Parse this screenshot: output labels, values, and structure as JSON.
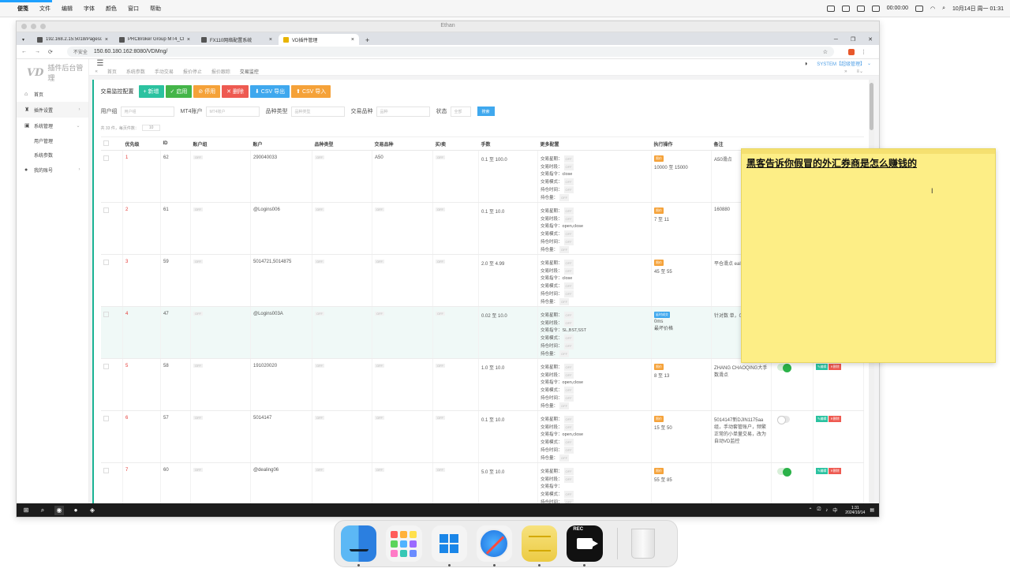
{
  "mac_menu": {
    "app": "便笺",
    "items": [
      "文件",
      "编辑",
      "字体",
      "颜色",
      "窗口",
      "帮助"
    ],
    "status_time": "00:00:00",
    "date_time": "10月14日 周一 01:31"
  },
  "remote": {
    "title": "Ethan",
    "tabs": [
      {
        "label": "192.168.2.15:5018/Pages/A"
      },
      {
        "label": "PRCBroker Group MT4_CRM"
      },
      {
        "label": "FX110网络配置系统"
      },
      {
        "label": "VD插件管理"
      }
    ],
    "insecure_label": "不安全",
    "url": "150.60.180.162:8080/VDMng/"
  },
  "app": {
    "brand_mark": "VD",
    "brand_title": "插件后台管理",
    "user_label": "SYSTEM【超级管理】",
    "sidebar": [
      {
        "label": "首页",
        "icon": "⌂"
      },
      {
        "label": "插件设置",
        "icon": "♜"
      },
      {
        "label": "系统管理",
        "icon": "▣"
      },
      {
        "label": "用户管理",
        "icon": ""
      },
      {
        "label": "系统参数",
        "icon": ""
      },
      {
        "label": "我的账号",
        "icon": "●"
      }
    ],
    "breadcrumbs": [
      "首页",
      "系统参数",
      "手动交易",
      "报价停止",
      "报价跟踪",
      "交易监控"
    ],
    "panel_title": "交易监控配置",
    "buttons": [
      "+ 新增",
      "✓ 启用",
      "⊘ 停用",
      "✕ 删除",
      "⬇ CSV 导出",
      "⬆ CSV 导入"
    ],
    "filters": [
      {
        "label": "用户组",
        "placeholder": "用户组"
      },
      {
        "label": "MT4账户",
        "placeholder": "MT4账户"
      },
      {
        "label": "品种类型",
        "placeholder": "品种类型"
      },
      {
        "label": "交易品种",
        "placeholder": "品种"
      },
      {
        "label": "状态",
        "placeholder": "全部"
      }
    ],
    "search_button": "搜索",
    "page_info": "共 33 件，每页件数：",
    "page_size": "10",
    "columns": [
      "",
      "优先级",
      "ID",
      "账户组",
      "账户",
      "品种类型",
      "交易品种",
      "买/卖",
      "手数",
      "更多配置",
      "执行操作",
      "备注",
      "",
      ""
    ],
    "rows": [
      {
        "priority": "1",
        "id": "62",
        "account": "290040033",
        "symbol": "A50",
        "lots": "0.1 至 100.0",
        "cfg_order": "close",
        "exec_badge": "限价",
        "exec_range": "10000 至 15000",
        "exec_extra": "",
        "note": "A50滑点"
      },
      {
        "priority": "2",
        "id": "61",
        "account": "@Logins006",
        "symbol": "",
        "lots": "0.1 至 10.0",
        "cfg_order": "open,close",
        "exec_badge": "限价",
        "exec_range": "7 至 11",
        "exec_extra": "",
        "note": "160880"
      },
      {
        "priority": "3",
        "id": "59",
        "account": "5014721,5014875",
        "symbol": "",
        "lots": "2.0 至 4.99",
        "cfg_order": "close",
        "exec_badge": "限价",
        "exec_range": "45 至 55",
        "exec_extra": "",
        "note": "平仓滑点 ealing0"
      },
      {
        "priority": "4",
        "id": "47",
        "account": "@Logins003A",
        "symbol": "",
        "lots": "0.02 至 10.0",
        "cfg_order": "SL,BST,SST",
        "exec_badge": "延时成交",
        "exec_range": "0ms",
        "exec_extra": "最坏价格",
        "note": "针对数 单，0.02 发布前扩"
      },
      {
        "priority": "5",
        "id": "58",
        "account": "191020020",
        "symbol": "",
        "lots": "1.0 至 10.0",
        "cfg_order": "open,close",
        "exec_badge": "限价",
        "exec_range": "8 至 13",
        "exec_extra": "",
        "note": "ZHANG CHAOQING大手数滑点"
      },
      {
        "priority": "6",
        "id": "57",
        "account": "5014147",
        "symbol": "",
        "lots": "0.1 至 10.0",
        "cfg_order": "open,close",
        "exec_badge": "限价",
        "exec_range": "15 至 50",
        "exec_extra": "",
        "note": "5014147新DJIN1175aa组，手动套管账户，频繁正常的小单量交易，改为自动VD监控"
      },
      {
        "priority": "7",
        "id": "60",
        "account": "@dealing06",
        "symbol": "",
        "lots": "5.0 至 10.0",
        "cfg_order": "",
        "exec_badge": "限价",
        "exec_range": "55 至 85",
        "exec_extra": "",
        "note": ""
      }
    ],
    "cfg_labels": [
      "交易星期：",
      "交易时段：",
      "交易指令：",
      "交易模式：",
      "持仓时间：",
      "持仓量："
    ],
    "gray_tag": "OFF",
    "edit_label": "✎编辑",
    "delete_label": "✕删除"
  },
  "taskbar": {
    "time": "1:31",
    "date": "2024/10/14"
  },
  "sticky": {
    "text": "黑客告诉你假冒的外汇券商是怎么赚钱的"
  },
  "dock": {
    "rec_label": "REC"
  }
}
